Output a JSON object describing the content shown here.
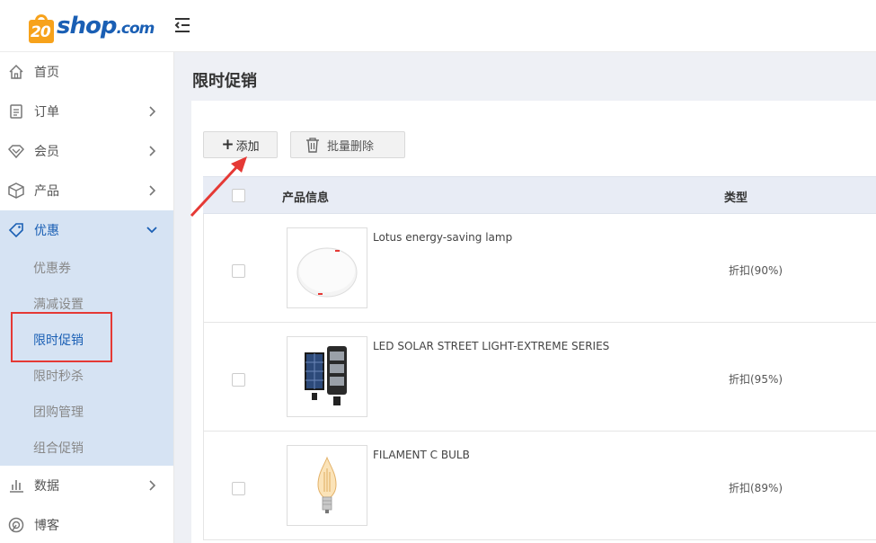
{
  "brand": {
    "logo_number": "20",
    "logo_word": "shop",
    "logo_suffix": ".com"
  },
  "sidebar": {
    "items": [
      {
        "label": "首页",
        "icon": "home-icon",
        "has_arrow": false
      },
      {
        "label": "订单",
        "icon": "order-icon",
        "has_arrow": true
      },
      {
        "label": "会员",
        "icon": "member-icon",
        "has_arrow": true
      },
      {
        "label": "产品",
        "icon": "product-icon",
        "has_arrow": true
      },
      {
        "label": "优惠",
        "icon": "tag-icon",
        "has_arrow": true,
        "expanded": true
      },
      {
        "label": "数据",
        "icon": "chart-icon",
        "has_arrow": true
      },
      {
        "label": "博客",
        "icon": "blog-icon",
        "has_arrow": false
      }
    ],
    "promo_submenu": [
      "优惠券",
      "满减设置",
      "限时促销",
      "限时秒杀",
      "团购管理",
      "组合促销"
    ],
    "current_sub": "限时促销"
  },
  "main": {
    "title": "限时促销",
    "add_button": "添加",
    "batch_delete_button": "批量删除",
    "columns": [
      "产品信息",
      "类型"
    ],
    "rows": [
      {
        "name": "Lotus energy-saving lamp",
        "type": "折扣(90%)",
        "image": "round-lamp"
      },
      {
        "name": "LED SOLAR STREET LIGHT-EXTREME SERIES",
        "type": "折扣(95%)",
        "image": "solar-street-light"
      },
      {
        "name": "FILAMENT C BULB",
        "type": "折扣(89%)",
        "image": "candle-bulb"
      }
    ]
  },
  "colors": {
    "accent": "#1a5fb4",
    "active_bg": "#d6e3f3",
    "logo_orange": "#f7a21b",
    "annotation_red": "#e53935"
  }
}
